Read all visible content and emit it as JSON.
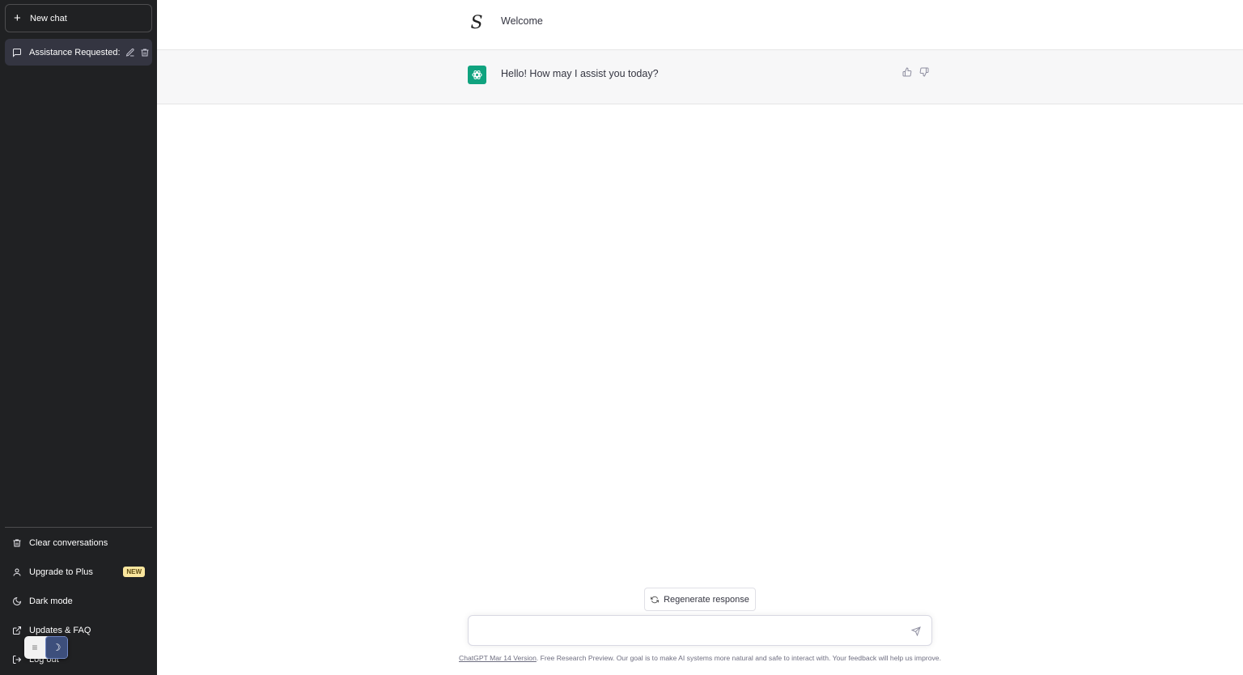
{
  "sidebar": {
    "new_chat_label": "New chat",
    "conversations": [
      {
        "title": "Assistance Requested:"
      }
    ],
    "menu": {
      "clear": "Clear conversations",
      "upgrade": "Upgrade to Plus",
      "upgrade_badge": "NEW",
      "dark_mode": "Dark mode",
      "updates": "Updates & FAQ",
      "logout": "Log out"
    }
  },
  "chat": {
    "user_avatar_letter": "S",
    "user_message": "Welcome",
    "bot_message": "Hello! How may I assist you today?"
  },
  "composer": {
    "regenerate_label": "Regenerate response",
    "placeholder": ""
  },
  "footer": {
    "version_link": "ChatGPT Mar 14 Version",
    "text": ". Free Research Preview. Our goal is to make AI systems more natural and safe to interact with. Your feedback will help us improve."
  },
  "colors": {
    "sidebar_bg": "#202123",
    "accent": "#10a37f",
    "badge_bg": "#fae69e"
  }
}
